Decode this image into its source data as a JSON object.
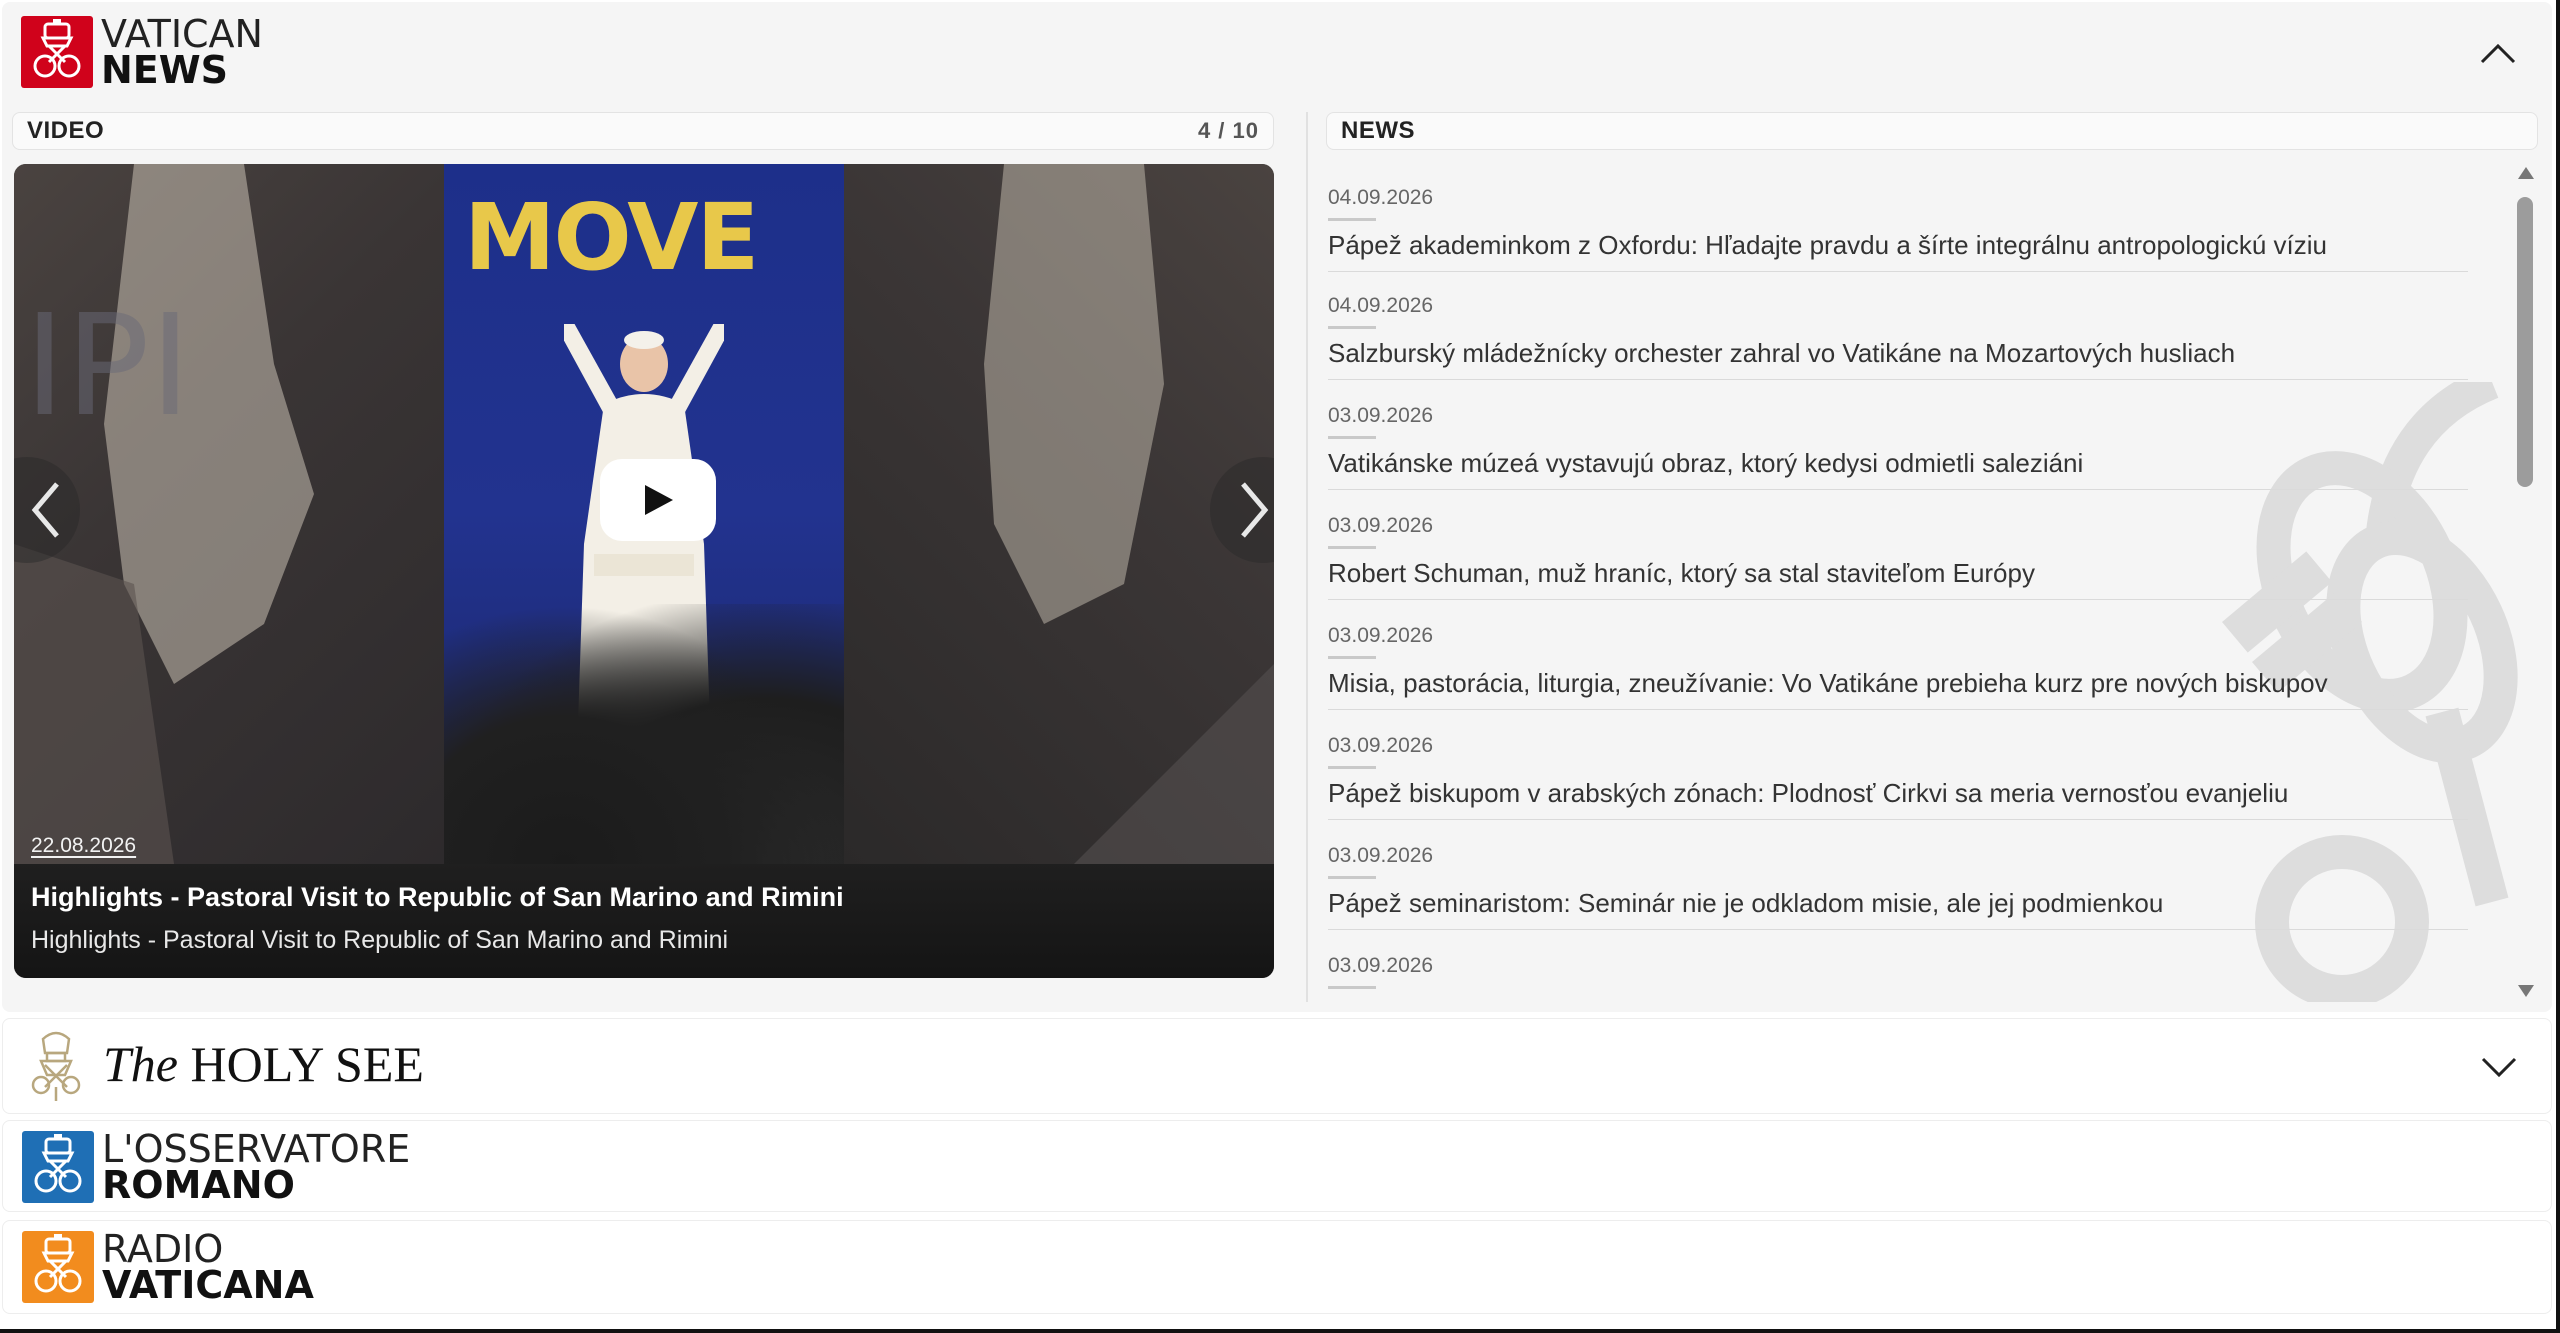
{
  "vatican_news": {
    "logo_line1": "VATICAN",
    "logo_line2": "NEWS",
    "brand_color": "#d0021b"
  },
  "video": {
    "section_label": "VIDEO",
    "counter": "4 / 10",
    "date": "22.08.2026",
    "title": "Highlights - Pastoral Visit to Republic of San Marino and Rimini",
    "subtitle": "Highlights - Pastoral Visit to Republic of San Marino and Rimini",
    "stage_text": "MOVE",
    "icons": {
      "play": "play-icon",
      "prev": "chevron-left-icon",
      "next": "chevron-right-icon"
    }
  },
  "news": {
    "section_label": "NEWS",
    "items": [
      {
        "date": "04.09.2026",
        "title": "Pápež akademinkom z Oxfordu: Hľadajte pravdu a šírte integrálnu antropologickú víziu"
      },
      {
        "date": "04.09.2026",
        "title": "Salzburský mládežnícky orchester zahral vo Vatikáne na Mozartových husliach"
      },
      {
        "date": "03.09.2026",
        "title": "Vatikánske múzeá vystavujú obraz, ktorý kedysi odmietli saleziáni"
      },
      {
        "date": "03.09.2026",
        "title": "Robert Schuman, muž hraníc, ktorý sa stal staviteľom Európy"
      },
      {
        "date": "03.09.2026",
        "title": "Misia, pastorácia, liturgia, zneužívanie: Vo Vatikáne prebieha kurz pre nových biskupov"
      },
      {
        "date": "03.09.2026",
        "title": "Pápež biskupom v arabských zónach: Plodnosť Cirkvi sa meria vernosťou evanjeliu"
      },
      {
        "date": "03.09.2026",
        "title": "Pápež seminaristom: Seminár nie je odkladom misie, ale jej podmienkou"
      },
      {
        "date": "03.09.2026",
        "title": ""
      }
    ]
  },
  "holy_see": {
    "the": "The",
    "name": "HOLY SEE"
  },
  "osservatore": {
    "logo_line1": "L'OSSERVATORE",
    "logo_line2": "ROMANO",
    "brand_color": "#1f6fb5"
  },
  "radio": {
    "logo_line1": "RADIO",
    "logo_line2": "VATICANA",
    "brand_color": "#f28c1e"
  }
}
